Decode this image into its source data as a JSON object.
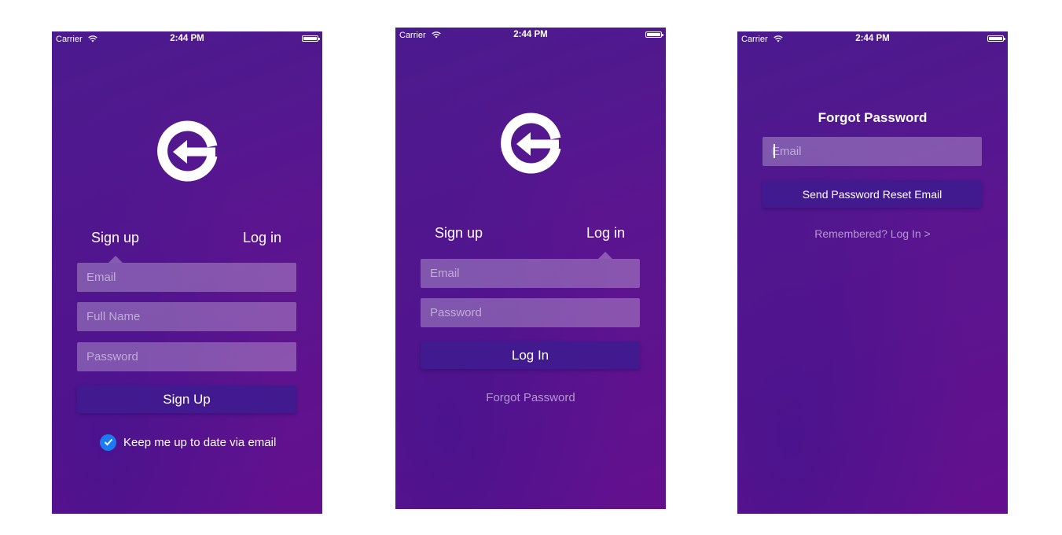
{
  "status_bar": {
    "carrier": "Carrier",
    "time": "2:44 PM"
  },
  "signup_screen": {
    "tabs": {
      "signup": "Sign up",
      "login": "Log in",
      "active": "signup"
    },
    "fields": {
      "email_placeholder": "Email",
      "full_name_placeholder": "Full Name",
      "password_placeholder": "Password"
    },
    "submit_label": "Sign Up",
    "newsletter": {
      "label": "Keep me up to date via email",
      "checked": true
    }
  },
  "login_screen": {
    "tabs": {
      "signup": "Sign up",
      "login": "Log in",
      "active": "login"
    },
    "fields": {
      "email_placeholder": "Email",
      "password_placeholder": "Password"
    },
    "submit_label": "Log In",
    "forgot_link": "Forgot Password"
  },
  "forgot_screen": {
    "title": "Forgot Password",
    "email_placeholder": "Email",
    "submit_label": "Send Password Reset Email",
    "remembered_link": "Remembered? Log In >"
  },
  "colors": {
    "gradient_start": "#4a1b8e",
    "gradient_end": "#64108e",
    "button": "#421a8f",
    "checkbox": "#1a7bf2"
  },
  "icons": [
    "wifi-icon",
    "battery-icon",
    "app-logo-icon",
    "checkmark-icon"
  ]
}
